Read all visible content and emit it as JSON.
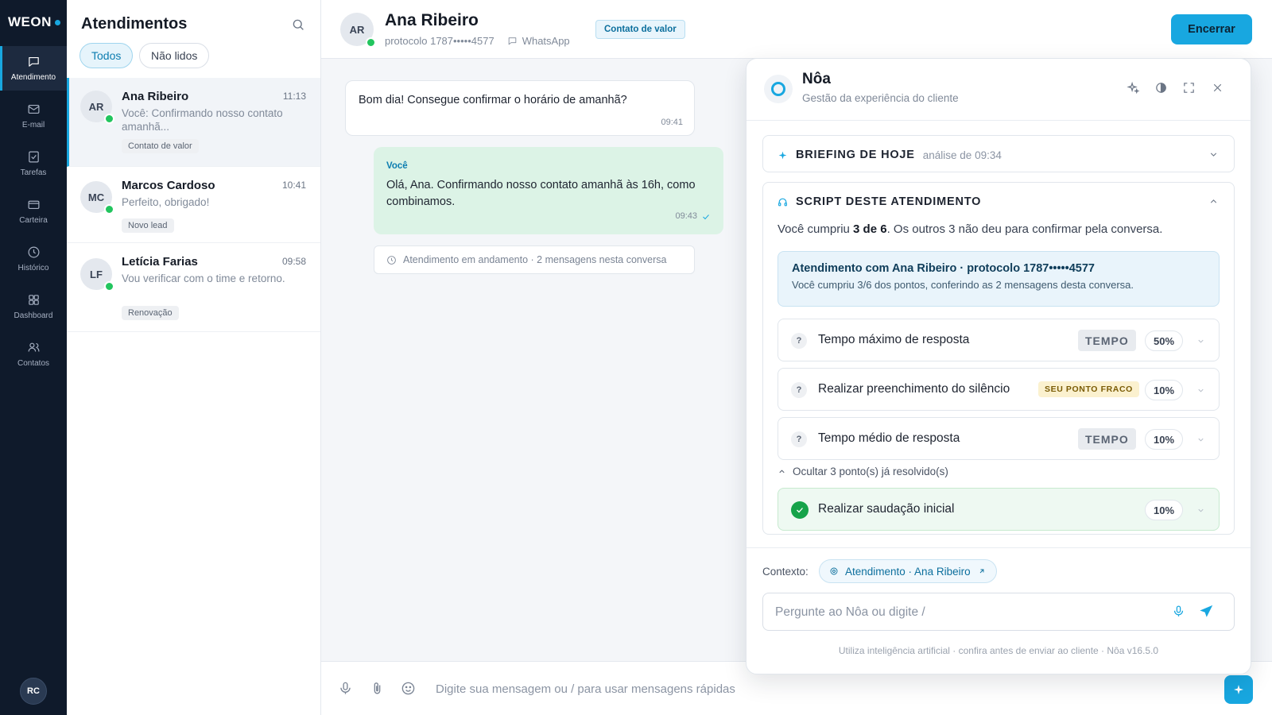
{
  "brand": {
    "name": "WEON",
    "accent": "#18a7e0",
    "rail_bg": "#0f1a2b"
  },
  "nav": {
    "items": [
      {
        "label": "Atendimento",
        "icon": "chat-bubble-icon",
        "active": true
      },
      {
        "label": "E-mail",
        "icon": "mail-icon"
      },
      {
        "label": "Tarefas",
        "icon": "checklist-icon"
      },
      {
        "label": "Carteira",
        "icon": "wallet-icon"
      },
      {
        "label": "Histórico",
        "icon": "clock-icon"
      },
      {
        "label": "Dashboard",
        "icon": "grid-icon"
      },
      {
        "label": "Contatos",
        "icon": "users-icon"
      }
    ],
    "user_initials": "RC"
  },
  "inbox": {
    "title": "Atendimentos",
    "filters": [
      {
        "label": "Todos",
        "active": true
      },
      {
        "label": "Não lidos"
      }
    ],
    "conversations": [
      {
        "initials": "AR",
        "name": "Ana Ribeiro",
        "time": "11:13",
        "preview": "Você: Confirmando nosso contato amanhã...",
        "tag": "Contato de valor",
        "active": true
      },
      {
        "initials": "MC",
        "name": "Marcos Cardoso",
        "time": "10:41",
        "preview": "Perfeito, obrigado!",
        "tag": "Novo lead"
      },
      {
        "initials": "LF",
        "name": "Letícia Farias",
        "time": "09:58",
        "preview": "Vou verificar com o time e retorno.",
        "tag": "Renovação"
      }
    ]
  },
  "chat": {
    "contact_initials": "AR",
    "contact_name": "Ana Ribeiro",
    "protocol": "protocolo 1787•••••4577",
    "channel": "WhatsApp",
    "badge": "Contato de valor",
    "end_label": "Encerrar",
    "messages": {
      "incoming": {
        "text": "Bom dia! Consegue confirmar o horário de amanhã?",
        "time": "09:41"
      },
      "outgoing": {
        "author": "Você",
        "text": "Olá, Ana. Confirmando nosso contato amanhã às 16h, como combinamos.",
        "time": "09:43"
      },
      "system": "Atendimento em andamento · 2 mensagens nesta conversa"
    },
    "composer_placeholder": "Digite sua mensagem ou / para usar mensagens rápidas"
  },
  "assistant": {
    "title": "Nôa",
    "subtitle": "Gestão da experiência do cliente",
    "briefing": {
      "title": "BRIEFING DE HOJE",
      "sub": "análise de 09:34"
    },
    "script": {
      "title": "SCRIPT DESTE ATENDIMENTO",
      "summary_prefix": "Você cumpriu ",
      "summary_bold": "3 de 6",
      "summary_suffix": ". Os outros 3 não deu para confirmar pela conversa.",
      "info_title": "Atendimento com Ana Ribeiro · protocolo 1787•••••4577",
      "info_body": "Você cumpriu 3/6 dos pontos, conferindo as 2 mensagens desta conversa.",
      "criteria": [
        {
          "label": "Tempo máximo de resposta",
          "pill": "TEMPO",
          "weight": "50%"
        },
        {
          "label": "Realizar preenchimento do silêncio",
          "pill": "SEU PONTO FRACO",
          "weight": "10%"
        },
        {
          "label": "Tempo médio de resposta",
          "pill": "TEMPO",
          "weight": "10%"
        }
      ],
      "resolved_toggle": "Ocultar 3 ponto(s) já resolvido(s)",
      "resolved": [
        {
          "label": "Realizar saudação inicial",
          "weight": "10%"
        }
      ]
    },
    "context_label": "Contexto:",
    "context_chip": "Atendimento · Ana Ribeiro",
    "ask_placeholder": "Pergunte ao Nôa ou digite /",
    "disclaimer": "Utiliza inteligência artificial · confira antes de enviar ao cliente · Nôa v16.5.0"
  }
}
